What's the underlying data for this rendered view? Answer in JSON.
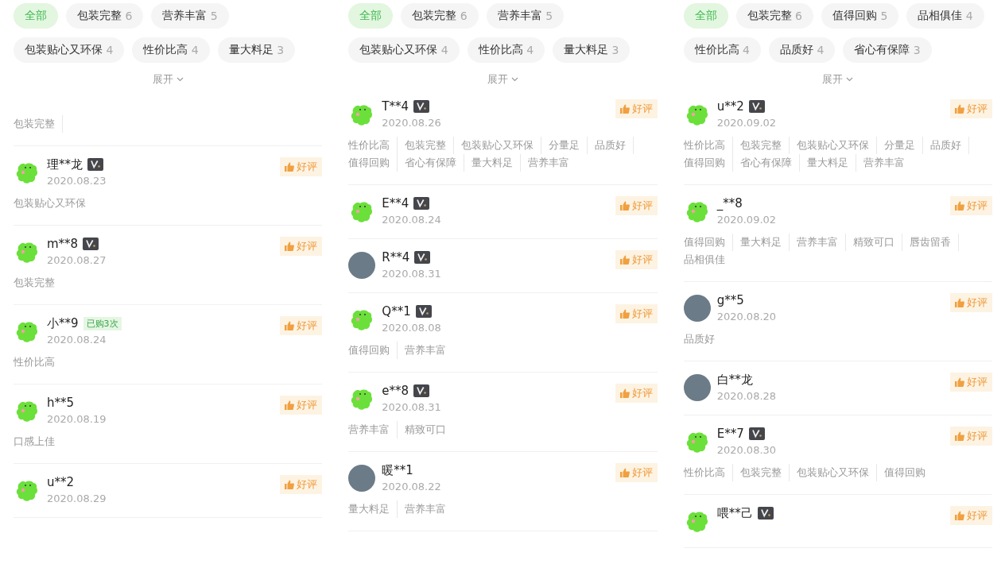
{
  "panels": [
    {
      "filters": [
        {
          "label": "全部",
          "selected": true
        },
        {
          "label": "包装完整",
          "count": "6",
          "selected": false
        },
        {
          "label": "营养丰富",
          "count": "5",
          "selected": false
        },
        {
          "label": "包装贴心又环保",
          "count": "4",
          "selected": false
        },
        {
          "label": "性价比高",
          "count": "4",
          "selected": false
        },
        {
          "label": "量大料足",
          "count": "3",
          "selected": false
        }
      ],
      "expand_label": "展开",
      "leading_tags": [
        "包装完整"
      ],
      "reviews": [
        {
          "kind": "mascot",
          "name": "理**龙",
          "badge": {
            "kind": "vip"
          },
          "date": "2020.08.23",
          "rating": "好评",
          "tags": [
            "包装贴心又环保"
          ]
        },
        {
          "kind": "mascot",
          "name": "m**8",
          "badge": {
            "kind": "vip"
          },
          "date": "2020.08.27",
          "rating": "好评",
          "tags": [
            "包装完整"
          ]
        },
        {
          "kind": "mascot",
          "name": "小**9",
          "badge": {
            "kind": "purchases",
            "text": "已购3次"
          },
          "date": "2020.08.24",
          "rating": "好评",
          "tags": [
            "性价比高"
          ]
        },
        {
          "kind": "mascot",
          "name": "h**5",
          "date": "2020.08.19",
          "rating": "好评",
          "tags": [
            "口感上佳"
          ]
        },
        {
          "kind": "mascot",
          "name": "u**2",
          "date": "2020.08.29",
          "rating": "好评"
        }
      ]
    },
    {
      "filters": [
        {
          "label": "全部",
          "selected": true
        },
        {
          "label": "包装完整",
          "count": "6",
          "selected": false
        },
        {
          "label": "营养丰富",
          "count": "5",
          "selected": false
        },
        {
          "label": "包装贴心又环保",
          "count": "4",
          "selected": false
        },
        {
          "label": "性价比高",
          "count": "4",
          "selected": false
        },
        {
          "label": "量大料足",
          "count": "3",
          "selected": false
        }
      ],
      "expand_label": "展开",
      "reviews": [
        {
          "kind": "mascot",
          "name": "T**4",
          "badge": {
            "kind": "vip"
          },
          "date": "2020.08.26",
          "rating": "好评",
          "tags": [
            "性价比高",
            "包装完整",
            "包装贴心又环保",
            "分量足",
            "品质好",
            "值得回购",
            "省心有保障",
            "量大料足",
            "营养丰富"
          ]
        },
        {
          "kind": "mascot",
          "name": "E**4",
          "badge": {
            "kind": "vip"
          },
          "date": "2020.08.24",
          "rating": "好评"
        },
        {
          "kind": "photo",
          "name": "R**4",
          "badge": {
            "kind": "vip"
          },
          "date": "2020.08.31",
          "rating": "好评"
        },
        {
          "kind": "mascot",
          "name": "Q**1",
          "badge": {
            "kind": "vip"
          },
          "date": "2020.08.08",
          "rating": "好评",
          "tags": [
            "值得回购",
            "营养丰富"
          ]
        },
        {
          "kind": "mascot",
          "name": "e**8",
          "badge": {
            "kind": "vip"
          },
          "date": "2020.08.31",
          "rating": "好评",
          "tags": [
            "营养丰富",
            "精致可口"
          ]
        },
        {
          "kind": "photo",
          "name": "暖**1",
          "date": "2020.08.22",
          "rating": "好评",
          "tags": [
            "量大料足",
            "营养丰富"
          ]
        }
      ]
    },
    {
      "filters": [
        {
          "label": "全部",
          "selected": true
        },
        {
          "label": "包装完整",
          "count": "6",
          "selected": false
        },
        {
          "label": "值得回购",
          "count": "5",
          "selected": false
        },
        {
          "label": "品相俱佳",
          "count": "4",
          "selected": false
        },
        {
          "label": "性价比高",
          "count": "4",
          "selected": false
        },
        {
          "label": "品质好",
          "count": "4",
          "selected": false
        },
        {
          "label": "省心有保障",
          "count": "3",
          "selected": false
        }
      ],
      "expand_label": "展开",
      "reviews": [
        {
          "kind": "mascot",
          "name": "u**2",
          "badge": {
            "kind": "vip"
          },
          "date": "2020.09.02",
          "rating": "好评",
          "tags": [
            "性价比高",
            "包装完整",
            "包装贴心又环保",
            "分量足",
            "品质好",
            "值得回购",
            "省心有保障",
            "量大料足",
            "营养丰富"
          ]
        },
        {
          "kind": "mascot",
          "name": "_**8",
          "date": "2020.09.02",
          "rating": "好评",
          "tags": [
            "值得回购",
            "量大料足",
            "营养丰富",
            "精致可口",
            "唇齿留香",
            "品相俱佳"
          ]
        },
        {
          "kind": "photo",
          "name": "g**5",
          "date": "2020.08.20",
          "rating": "好评",
          "tags": [
            "品质好"
          ]
        },
        {
          "kind": "photo",
          "name": "白**龙",
          "date": "2020.08.28",
          "rating": "好评"
        },
        {
          "kind": "mascot",
          "name": "E**7",
          "badge": {
            "kind": "vip"
          },
          "date": "2020.08.30",
          "rating": "好评",
          "tags": [
            "性价比高",
            "包装完整",
            "包装贴心又环保",
            "值得回购"
          ]
        },
        {
          "kind": "mascot",
          "name": "喂**己",
          "badge": {
            "kind": "vip"
          },
          "rating": "好评"
        }
      ]
    }
  ]
}
